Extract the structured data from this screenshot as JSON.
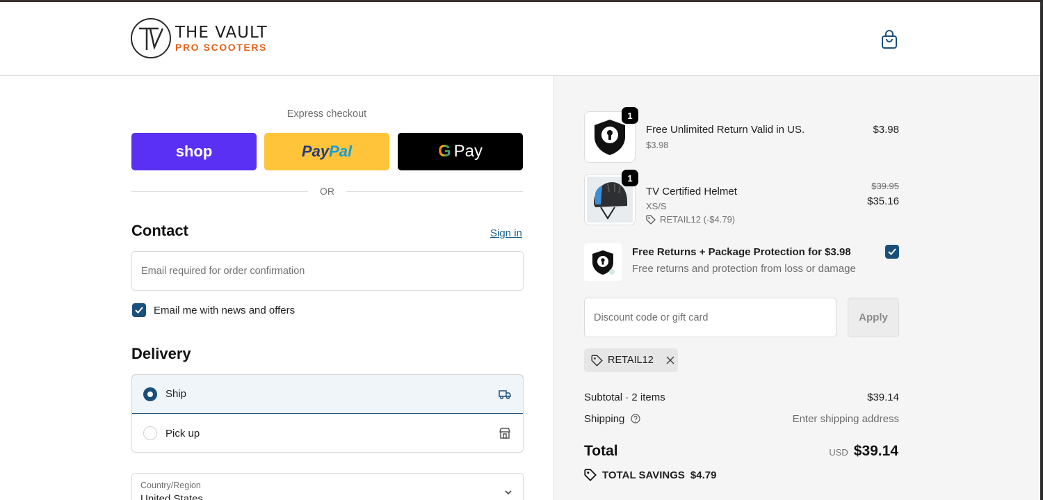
{
  "brand": {
    "logo_letters": "TV",
    "line1": "THE VAULT",
    "line2": "PRO SCOOTERS",
    "accent_color": "#e0631c"
  },
  "header": {
    "cart_icon": "shopping-bag-icon"
  },
  "express": {
    "title": "Express checkout",
    "shop_label": "shop",
    "paypal_dark": "Pay",
    "paypal_light": "Pal",
    "gpay_g": "G",
    "gpay_label": "Pay",
    "or_label": "OR"
  },
  "contact": {
    "heading": "Contact",
    "signin_label": "Sign in",
    "email_placeholder": "Email required for order confirmation",
    "newsletter_label": "Email me with news and offers",
    "newsletter_checked": true
  },
  "delivery": {
    "heading": "Delivery",
    "options": [
      {
        "label": "Ship",
        "selected": true,
        "icon": "truck-icon"
      },
      {
        "label": "Pick up",
        "selected": false,
        "icon": "store-icon"
      }
    ],
    "country_label": "Country/Region",
    "country_value": "United States"
  },
  "cart": {
    "items": [
      {
        "title": "Free Unlimited Return Valid in US.",
        "subtitle": "$3.98",
        "price": "$3.98",
        "qty": "1"
      },
      {
        "title": "TV Certified Helmet",
        "subtitle": "XS/S",
        "original_price": "$39.95",
        "price": "$35.16",
        "discount": "RETAIL12 (-$4.79)",
        "qty": "1"
      }
    ],
    "protection": {
      "title": "Free Returns + Package Protection for $3.98",
      "subtitle": "Free returns and protection from loss or damage",
      "checked": true
    },
    "discount_placeholder": "Discount code or gift card",
    "apply_label": "Apply",
    "applied_code": "RETAIL12",
    "subtotal_label": "Subtotal · 2 items",
    "subtotal_value": "$39.14",
    "shipping_label": "Shipping",
    "shipping_value": "Enter shipping address",
    "total_label": "Total",
    "currency": "USD",
    "total_value": "$39.14",
    "savings_label": "TOTAL SAVINGS",
    "savings_value": "$4.79"
  },
  "colors": {
    "primary": "#1a4f7a",
    "shop_pay": "#5a31f4",
    "paypal": "#ffc439"
  }
}
